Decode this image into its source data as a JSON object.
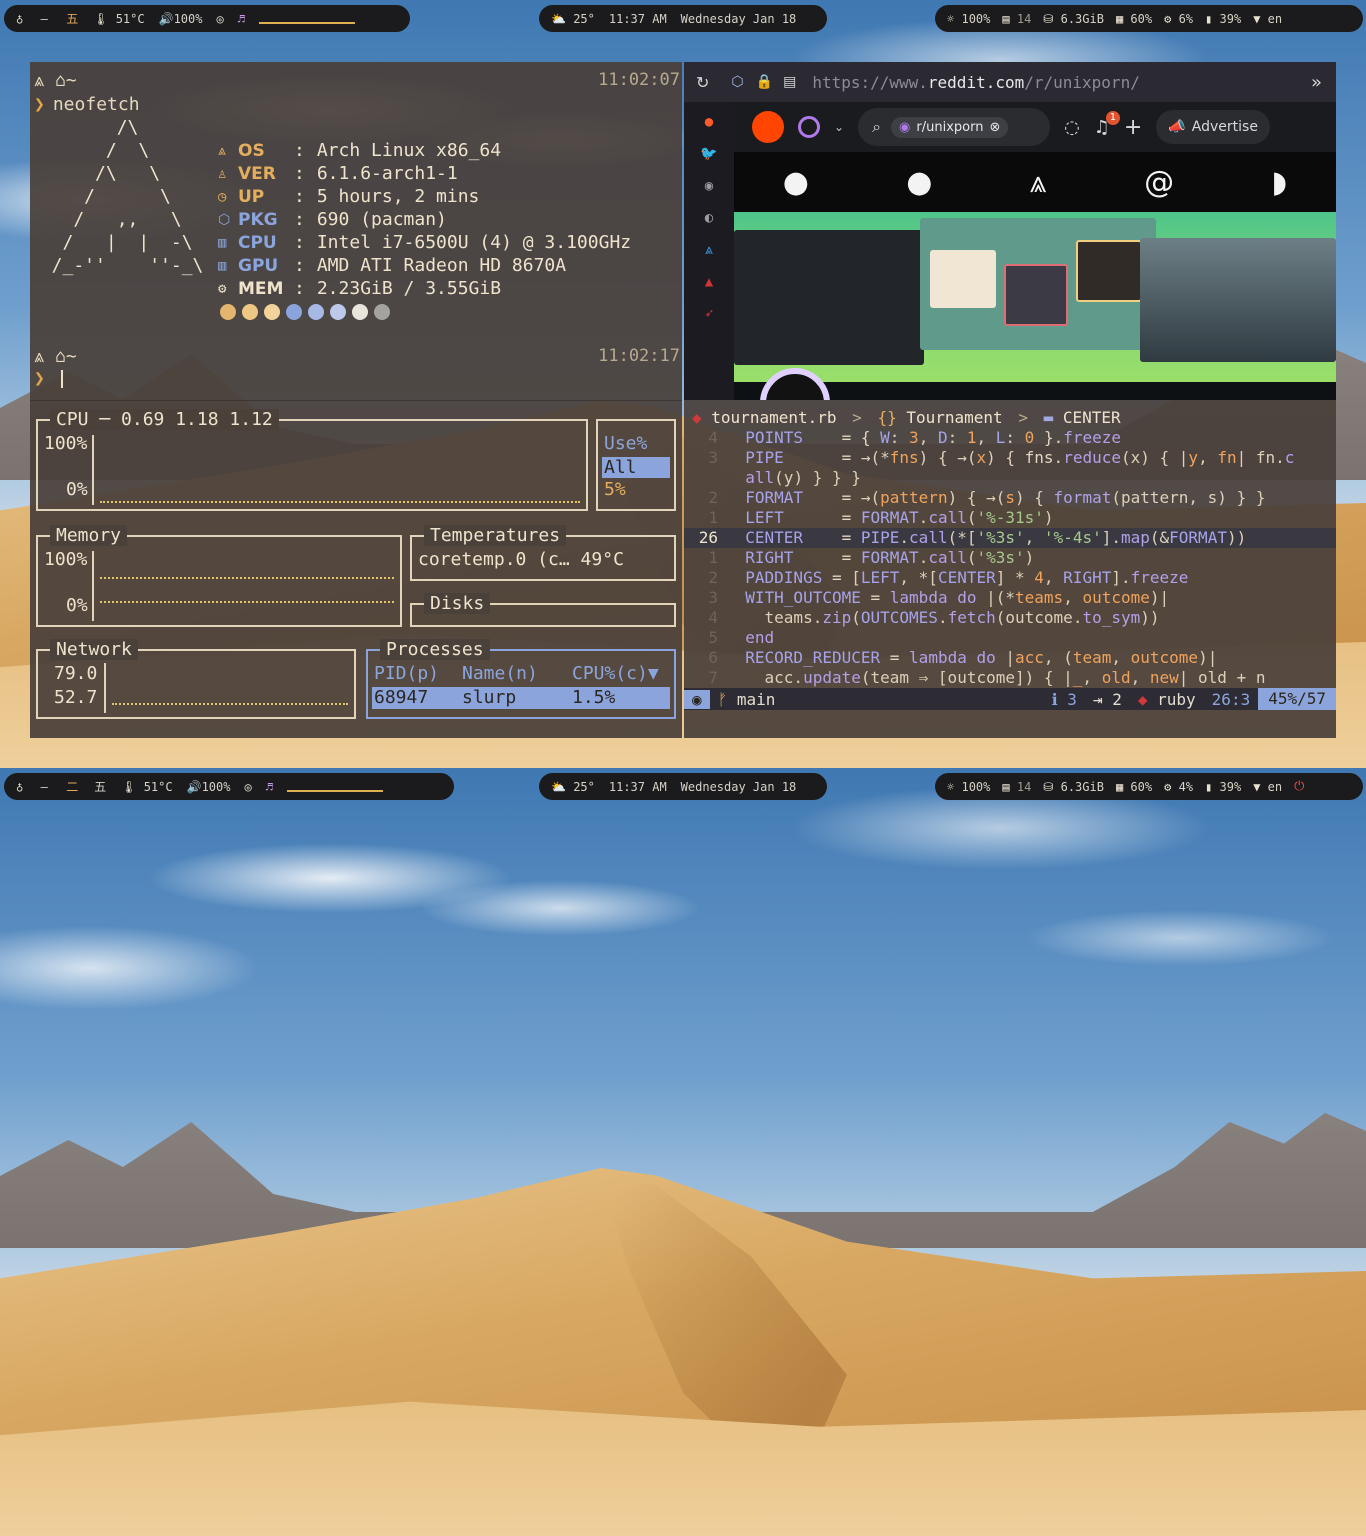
{
  "top_bar": {
    "arch_glyph": "♁",
    "workspaces": [
      "—",
      "五"
    ],
    "temperature": "51°C",
    "volume": "100%",
    "weather_temp": "25°",
    "time": "11:37 AM",
    "date": "Wednesday Jan 18",
    "brightness": "100%",
    "updates": "14",
    "disk": "6.3GiB",
    "mem_pct": "60%",
    "cpu_pct": "6%",
    "battery": "39%",
    "lang": "en"
  },
  "bottom_bar": {
    "arch_glyph": "♁",
    "workspaces": [
      "—",
      "二",
      "五"
    ],
    "temperature": "51°C",
    "volume": "100%",
    "weather_temp": "25°",
    "time": "11:37 AM",
    "date": "Wednesday Jan 18",
    "brightness": "100%",
    "updates": "14",
    "disk": "6.3GiB",
    "mem_pct": "60%",
    "cpu_pct": "4%",
    "battery": "39%",
    "lang": "en"
  },
  "neofetch": {
    "prompt_dir": "~",
    "time1": "11:02:07",
    "time2": "11:02:17",
    "command": "neofetch",
    "ascii": "        /\\\n       /  \\\n      /\\   \\\n     /      \\\n    /   ,,   \\\n   /   |  |  -\\\n  /_-''    ''-_\\",
    "rows": [
      {
        "key": "OS",
        "sep": ":",
        "value": "Arch Linux x86_64"
      },
      {
        "key": "VER",
        "sep": ":",
        "value": "6.1.6-arch1-1"
      },
      {
        "key": "UP",
        "sep": ":",
        "value": "5 hours, 2 mins"
      },
      {
        "key": "PKG",
        "sep": ":",
        "value": "690 (pacman)"
      },
      {
        "key": "CPU",
        "sep": ":",
        "value": "Intel i7-6500U (4) @ 3.100GHz"
      },
      {
        "key": "GPU",
        "sep": ":",
        "value": "AMD ATI Radeon HD 8670A"
      },
      {
        "key": "MEM",
        "sep": ":",
        "value": "2.23GiB / 3.55GiB"
      }
    ],
    "swatches": [
      "#e3b56d",
      "#edc784",
      "#f2d39a",
      "#8ba5dc",
      "#a6b9e5",
      "#bcc9ea",
      "#e9e5dc",
      "#a5a3a0"
    ]
  },
  "btop": {
    "cpu_title": "CPU",
    "cpu_load": "0.69 1.18 1.12",
    "cpu_max": "100%",
    "cpu_min": "0%",
    "use_label": "Use%",
    "use_all": "All",
    "use_value": "5%",
    "mem_title": "Memory",
    "mem_max": "100%",
    "mem_min": "0%",
    "temp_title": "Temperatures",
    "temp_row": "coretemp.0 (c… 49°C",
    "disks_title": "Disks",
    "net_title": "Network",
    "net_down": "79.0",
    "net_up": "52.7",
    "proc_title": "Processes",
    "proc_headers": [
      "PID(p)",
      "Name(n)",
      "CPU%(c)▼"
    ],
    "proc_rows": [
      [
        "68947",
        "slurp",
        "1.5%"
      ]
    ]
  },
  "browser": {
    "url_scheme": "https://",
    "url_www": "www.",
    "url_host": "reddit.com",
    "url_path": "/r/unixporn/",
    "subreddit_chip": "r/unixporn",
    "notif_count": "1",
    "advertise_label": "Advertise"
  },
  "editor": {
    "file": "tournament.rb",
    "crumb_class": "Tournament",
    "crumb_const": "CENTER",
    "lines": [
      {
        "n": "4",
        "html": "<span class='c'>POINTS</span>    <span class='p'>= {</span> <span class='c'>W</span>: <span class='n'>3</span>, <span class='c'>D</span>: <span class='n'>1</span>, <span class='c'>L</span>: <span class='n'>0</span> <span class='p'>}</span>.<span class='k'>freeze</span>"
      },
      {
        "n": "3",
        "html": "<span class='c'>PIPE</span>      <span class='p'>=</span> →(*<span class='n'>fns</span>) { →(<span class='n'>x</span>) { <span class='p'>fns</span>.<span class='k'>reduce</span>(x) { |<span class='n'>y</span>, <span class='n'>fn</span>| fn.<span class='k'>c</span>"
      },
      {
        "n": "",
        "html": "<span class='k'>all</span>(y) } } }"
      },
      {
        "n": "2",
        "html": "<span class='c'>FORMAT</span>    <span class='p'>=</span> →(<span class='n'>pattern</span>) { →(<span class='n'>s</span>) { <span class='k'>format</span>(pattern, s) } }"
      },
      {
        "n": "1",
        "html": "<span class='c'>LEFT</span>      <span class='p'>=</span> <span class='c'>FORMAT</span>.<span class='k'>call</span>(<span class='s'>'%-31s'</span>)"
      },
      {
        "n": "26",
        "cur": true,
        "html": "<span class='c'>CENTER</span>    <span class='p'>=</span> <span class='c'>PIPE</span>.<span class='k'>call</span>(*[<span class='s'>'%3s'</span>, <span class='s'>'%-4s'</span>].<span class='k'>map</span>(&amp;<span class='c'>FORMAT</span>))"
      },
      {
        "n": "1",
        "html": "<span class='c'>RIGHT</span>     <span class='p'>=</span> <span class='c'>FORMAT</span>.<span class='k'>call</span>(<span class='s'>'%3s'</span>)"
      },
      {
        "n": "2",
        "html": "<span class='c'>PADDINGS</span> <span class='p'>=</span> [<span class='c'>LEFT</span>, *[<span class='c'>CENTER</span>] * <span class='n'>4</span>, <span class='c'>RIGHT</span>].<span class='k'>freeze</span>"
      },
      {
        "n": "3",
        "html": "<span class='c'>WITH_OUTCOME</span> <span class='p'>=</span> <span class='k'>lambda do</span> |(*<span class='n'>teams</span>, <span class='n'>outcome</span>)|"
      },
      {
        "n": "4",
        "html": "  teams.<span class='k'>zip</span>(<span class='c'>OUTCOMES</span>.<span class='k'>fetch</span>(outcome.<span class='k'>to_sym</span>))"
      },
      {
        "n": "5",
        "html": "<span class='k'>end</span>"
      },
      {
        "n": "6",
        "html": "<span class='c'>RECORD_REDUCER</span> <span class='p'>=</span> <span class='k'>lambda do</span> |<span class='n'>acc</span>, (<span class='n'>team</span>, <span class='n'>outcome</span>)|"
      },
      {
        "n": "7",
        "html": "  acc.<span class='k'>update</span>(team ⇒ [outcome]) { |<span class='n'>_</span>, <span class='n'>old</span>, <span class='n'>new</span>| old + n"
      }
    ],
    "status_branch": "main",
    "status_info": "3",
    "status_hint": "2",
    "status_lang": "ruby",
    "status_pos": "26:3",
    "status_pct": "45%/57"
  }
}
